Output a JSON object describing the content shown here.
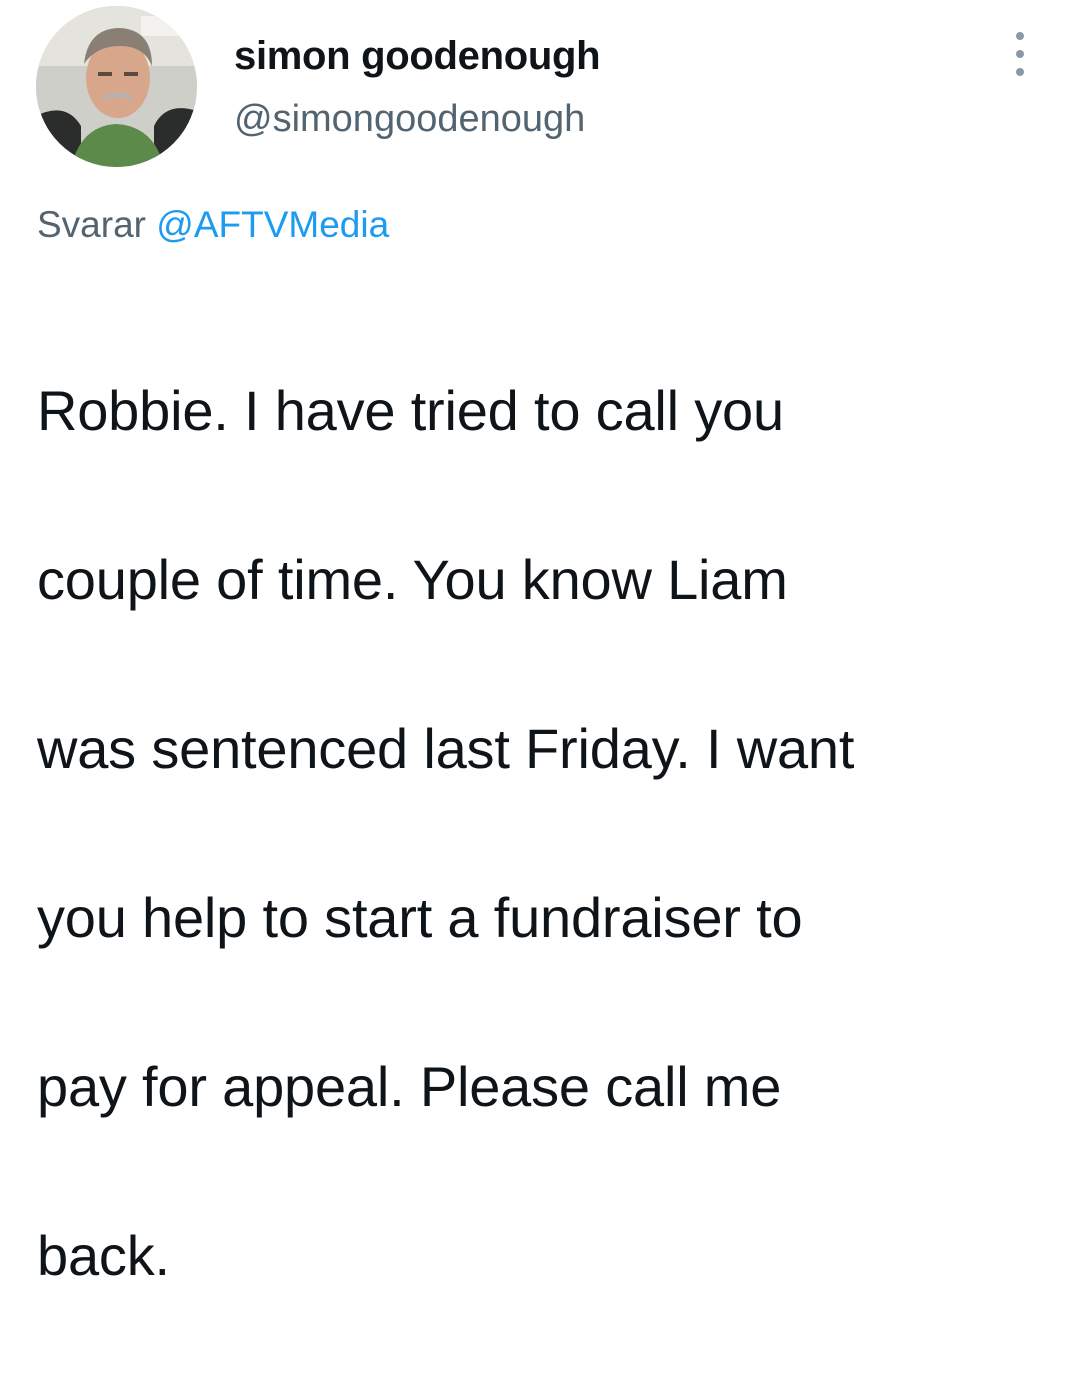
{
  "author": {
    "display_name": "simon goodenough",
    "handle": "@simongoodenough",
    "avatar": "profile-photo"
  },
  "reply": {
    "prefix": "Svarar",
    "mention": "@AFTVMedia"
  },
  "tweet": {
    "lines": [
      "Robbie. I have tried to call you",
      "couple of time. You know Liam",
      "was sentenced last Friday. I want",
      "you help to start a fundraiser to",
      "pay for appeal. Please call me",
      "back."
    ]
  },
  "icons": {
    "more": "more-vertical-icon"
  },
  "colors": {
    "text": "#0f1419",
    "secondary": "#536471",
    "link": "#1d9bf0"
  }
}
